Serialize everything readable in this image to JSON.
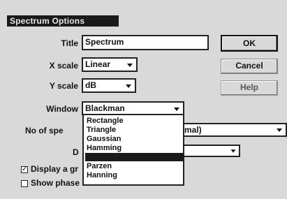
{
  "window": {
    "title": "Spectrum Options"
  },
  "fields": {
    "title_label": "Title",
    "title_value": "Spectrum",
    "xscale_label": "X scale",
    "xscale_value": "Linear",
    "yscale_label": "Y scale",
    "yscale_value": "dB",
    "window_label": "Window",
    "window_value": "Blackman",
    "nospectra_label": "No of spe",
    "nospectra_value": "mal)",
    "d_label": "D"
  },
  "buttons": {
    "ok": "OK",
    "cancel": "Cancel",
    "help": "Help"
  },
  "window_options": [
    {
      "label": "Rectangle",
      "selected": false
    },
    {
      "label": "Triangle",
      "selected": false
    },
    {
      "label": "Gaussian",
      "selected": false
    },
    {
      "label": "Hamming",
      "selected": false
    },
    {
      "label": "Blackman",
      "selected": true
    },
    {
      "label": "Parzen",
      "selected": false
    },
    {
      "label": "Hanning",
      "selected": false
    }
  ],
  "checkboxes": [
    {
      "label": "Display a gr",
      "checked": true
    },
    {
      "label": "Show phase",
      "checked": false
    }
  ]
}
